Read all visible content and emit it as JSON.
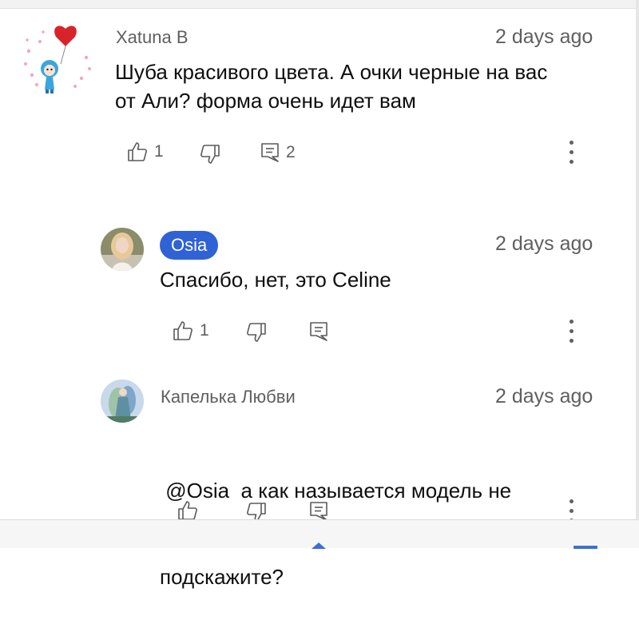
{
  "comments": [
    {
      "author": "Xatuna B",
      "time": "2 days ago",
      "text_lines": [
        "Шуба красивого цвета. А очки черные на вас",
        "от Али? форма очень идет вам"
      ],
      "likes": "1",
      "replies": "2"
    },
    {
      "author": "Osia",
      "time": "2 days ago",
      "text_lines": [
        "Спасибо, нет, это Celine"
      ],
      "likes": "1"
    },
    {
      "author": "Капелька Любви",
      "time": "2 days ago",
      "text_lines": [
        " @Osia  а как называется модель не",
        "подскажите?"
      ]
    }
  ],
  "colors": {
    "badge": "#2f62d4",
    "secondary_text": "#5f5f5f",
    "accent": "#3b6fd8"
  },
  "icons": {
    "like": "thumbs-up-icon",
    "dislike": "thumbs-down-icon",
    "reply": "reply-comment-icon",
    "more": "more-vertical-icon"
  }
}
